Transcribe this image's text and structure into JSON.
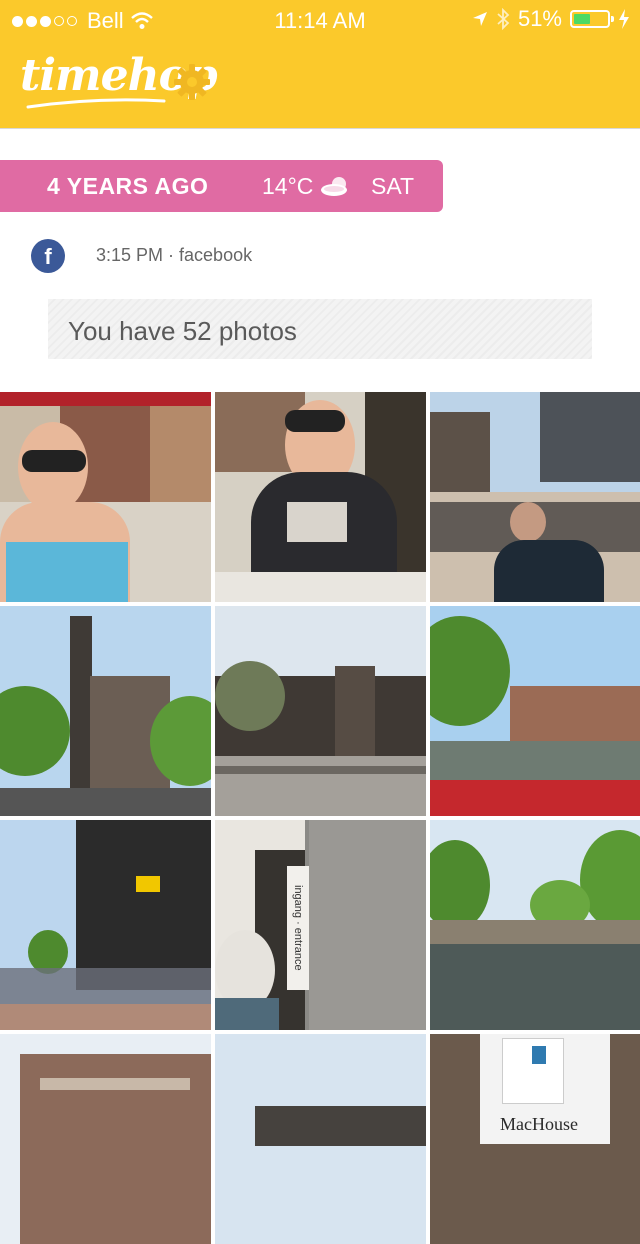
{
  "status_bar": {
    "carrier": "Bell",
    "time": "11:14 AM",
    "battery": "51%",
    "battery_level": 0.51,
    "signal_dots_filled": 3,
    "signal_dots_total": 5
  },
  "header": {
    "logo_text": "timehop",
    "brand_color": "#fbc92b",
    "settings_icon": "gear-icon"
  },
  "banner": {
    "years_ago": "4 YEARS AGO",
    "temperature": "14°C",
    "weather_icon": "cloudy-icon",
    "day": "SAT",
    "color": "#e06ba3"
  },
  "post": {
    "source_icon": "facebook-icon",
    "source_letter": "f",
    "meta": "3:15 PM · facebook",
    "photos_text": "You have 52 photos"
  },
  "photos": [
    {
      "name": "photo-woman-street"
    },
    {
      "name": "photo-woman-table"
    },
    {
      "name": "photo-square-crowd"
    },
    {
      "name": "photo-church-tower"
    },
    {
      "name": "photo-canal-houses"
    },
    {
      "name": "photo-canal-fence"
    },
    {
      "name": "photo-queue-street"
    },
    {
      "name": "photo-entrance-sign"
    },
    {
      "name": "photo-canal-boats"
    },
    {
      "name": "photo-old-building"
    },
    {
      "name": "photo-sky-rooftop"
    },
    {
      "name": "photo-machouse-sign"
    }
  ],
  "photo_captions": {
    "entrance_sign": "ingang · entrance",
    "machouse": "MacHouse"
  }
}
